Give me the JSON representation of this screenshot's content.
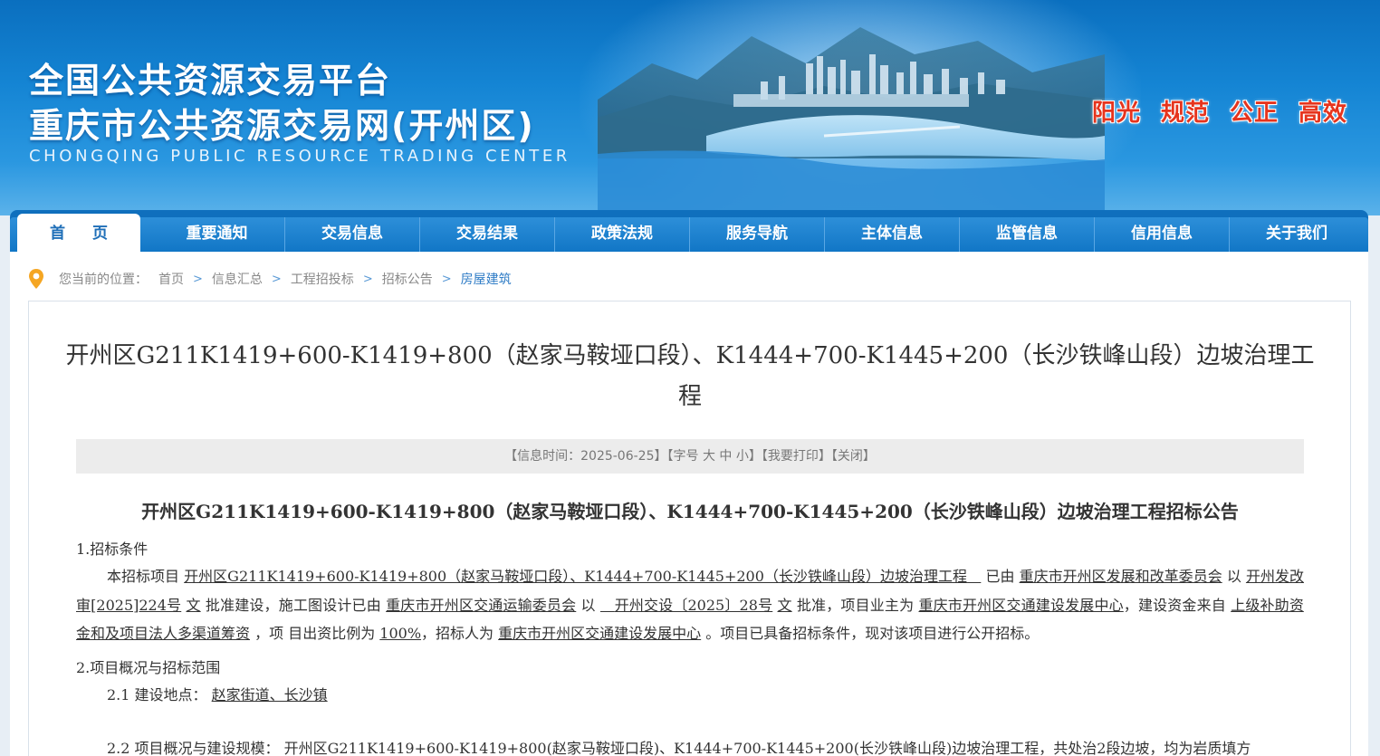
{
  "header": {
    "title_line1": "全国公共资源交易平台",
    "title_line2": "重庆市公共资源交易网(开州区)",
    "title_en": "CHONGQING PUBLIC RESOURCE TRADING CENTER",
    "slogans": [
      "阳光",
      "规范",
      "公正",
      "高效"
    ]
  },
  "nav": {
    "items": [
      "首页",
      "重要通知",
      "交易信息",
      "交易结果",
      "政策法规",
      "服务导航",
      "主体信息",
      "监管信息",
      "信用信息",
      "关于我们"
    ]
  },
  "breadcrumb": {
    "label": "您当前的位置：",
    "items": [
      "首页",
      "信息汇总",
      "工程招投标",
      "招标公告",
      "房屋建筑"
    ]
  },
  "article": {
    "title": "开州区G211K1419+600-K1419+800（赵家马鞍垭口段）、K1444+700-K1445+200（长沙铁峰山段）边坡治理工程",
    "meta": {
      "time_label": "【信息时间：",
      "time": "2025-06-25",
      "time_close": "】",
      "font_label": "【字号",
      "font_large": "大",
      "font_medium": "中",
      "font_small": "小",
      "font_close": "】",
      "print": "【我要打印】",
      "close": "【关闭】"
    },
    "doc_title": "开州区G211K1419+600-K1419+800（赵家马鞍垭口段）、K1444+700-K1445+200（长沙铁峰山段）边坡治理工程招标公告",
    "s1_heading": "1.招标条件",
    "s1": {
      "t1": "本招标项目",
      "project": "开州区G211K1419+600-K1419+800（赵家马鞍垭口段）、K1444+700-K1445+200（长沙铁峰山段）边坡治理工程",
      "t2": "已由",
      "approver": "重庆市开州区发展和改革委员会",
      "t3": "以",
      "approval_no": "开州发改审[2025]224号",
      "t4": "文",
      "t5": "批准建设，施工图设计已由",
      "design_approver": "重庆市开州区交通运输委员会",
      "t6": "以",
      "design_no": "开州交设〔2025〕28号",
      "t7": "文",
      "t8": "批准，项目业主为",
      "owner": "重庆市开州区交通建设发展中心",
      "t9": "，建设资金来自",
      "funds": "上级补助资金和及项目法人多渠道筹资",
      "t10": "，项 目出资比例为",
      "ratio": "100%",
      "t11": "，招标人为",
      "tenderer": "重庆市开州区交通建设发展中心",
      "t12": "。项目已具备招标条件，现对该项目进行公开招标。"
    },
    "s2_heading": "2.项目概况与招标范围",
    "s2_1_label": "2.1  建设地点：",
    "s2_1_value": "赵家街道、长沙镇",
    "s2_2_partial": "2.2  项目概况与建设规模：  开州区G211K1419+600-K1419+800(赵家马鞍垭口段)、K1444+700-K1445+200(长沙铁峰山段)边坡治理工程，共处治2段边坡，均为岩质填方"
  },
  "colors": {
    "nav_blue": "#1176c6",
    "slogan_red": "#e6341d",
    "link_blue": "#2f7cc6"
  }
}
